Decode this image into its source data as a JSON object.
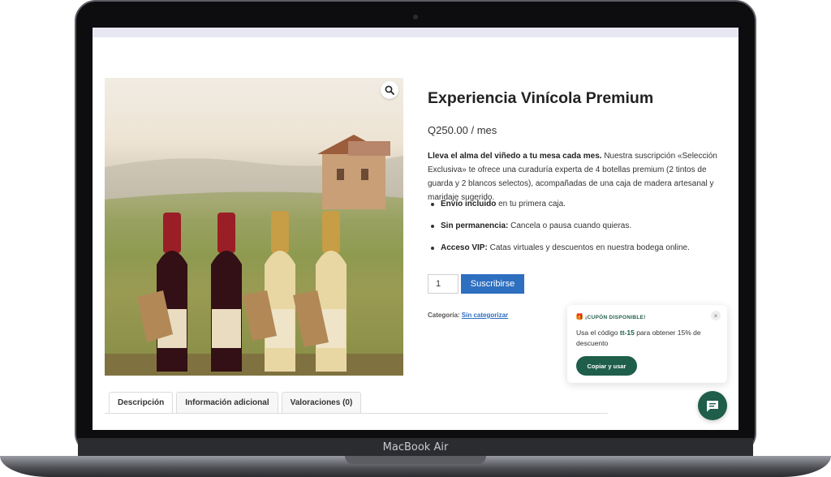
{
  "device": {
    "label": "MacBook Air"
  },
  "product": {
    "title": "Experiencia Vinícola Premium",
    "price": "Q250.00 / mes",
    "description_bold": "Lleva el alma del viñedo a tu mesa cada mes.",
    "description_rest": " Nuestra suscripción «Selección Exclusiva» te ofrece una curaduría experta de 4 botellas premium (2 tintos de guarda y 2 blancos selectos), acompañadas de una caja de madera artesanal y maridaje sugerido.",
    "bullets": [
      {
        "bold": "Envío incluido",
        "text": " en tu primera caja."
      },
      {
        "bold": "Sin permanencia:",
        "text": " Cancela o pausa cuando quieras."
      },
      {
        "bold": "Acceso VIP:",
        "text": " Catas virtuales y descuentos en nuestra bodega online."
      }
    ],
    "quantity": "1",
    "subscribe_label": "Suscribirse",
    "category_label": "Categoría:",
    "category_value": "Sin categorizar"
  },
  "coupon": {
    "icon_emoji": "🎁",
    "title": "¡CUPÓN DISPONIBLE!",
    "text_before": "Usa el código ",
    "code": "tt-15",
    "text_after": " para obtener 15% de descuento",
    "button_label": "Copiar y usar",
    "close_label": "×"
  },
  "tabs": [
    {
      "label": "Descripción",
      "active": true
    },
    {
      "label": "Información adicional",
      "active": false
    },
    {
      "label": "Valoraciones (0)",
      "active": false
    }
  ],
  "colors": {
    "accent": "#2e6fc0",
    "coupon_green": "#1f5e4a"
  }
}
